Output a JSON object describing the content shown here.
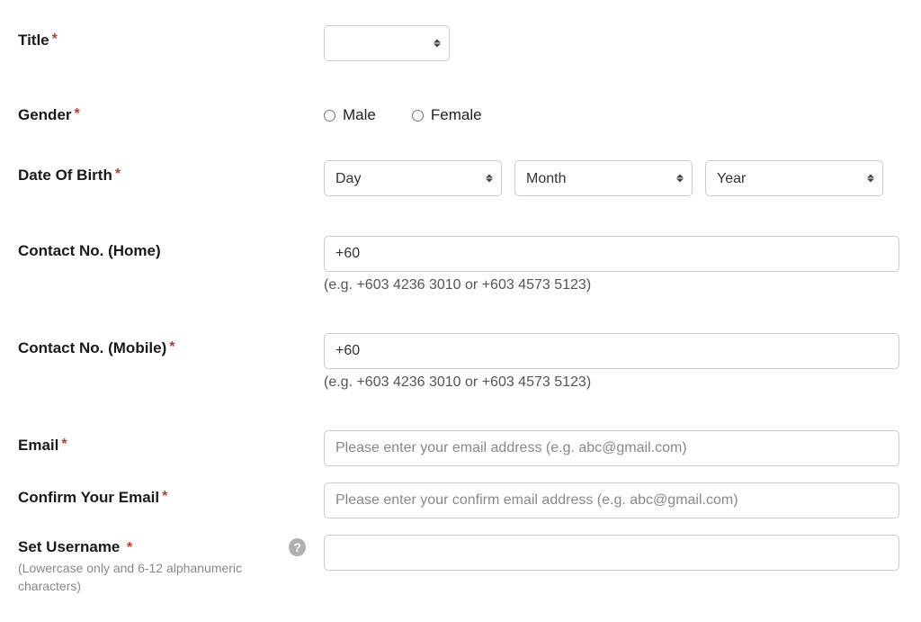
{
  "title": {
    "label": "Title",
    "value": ""
  },
  "gender": {
    "label": "Gender",
    "options": {
      "male": "Male",
      "female": "Female"
    }
  },
  "dob": {
    "label": "Date Of Birth",
    "day": "Day",
    "month": "Month",
    "year": "Year"
  },
  "contact_home": {
    "label": "Contact No. (Home)",
    "value": "+60",
    "helper": "(e.g. +603 4236 3010 or +603 4573 5123)"
  },
  "contact_mobile": {
    "label": "Contact No. (Mobile)",
    "value": "+60",
    "helper": "(e.g. +603 4236 3010 or +603 4573 5123)"
  },
  "email": {
    "label": "Email",
    "placeholder": "Please enter your email address (e.g. abc@gmail.com)"
  },
  "confirm_email": {
    "label": "Confirm Your Email",
    "placeholder": "Please enter your confirm email address (e.g. abc@gmail.com)"
  },
  "username": {
    "label": "Set Username",
    "helper": "(Lowercase only and 6-12 alphanumeric characters)"
  },
  "required_mark": "*",
  "help_icon": "?"
}
